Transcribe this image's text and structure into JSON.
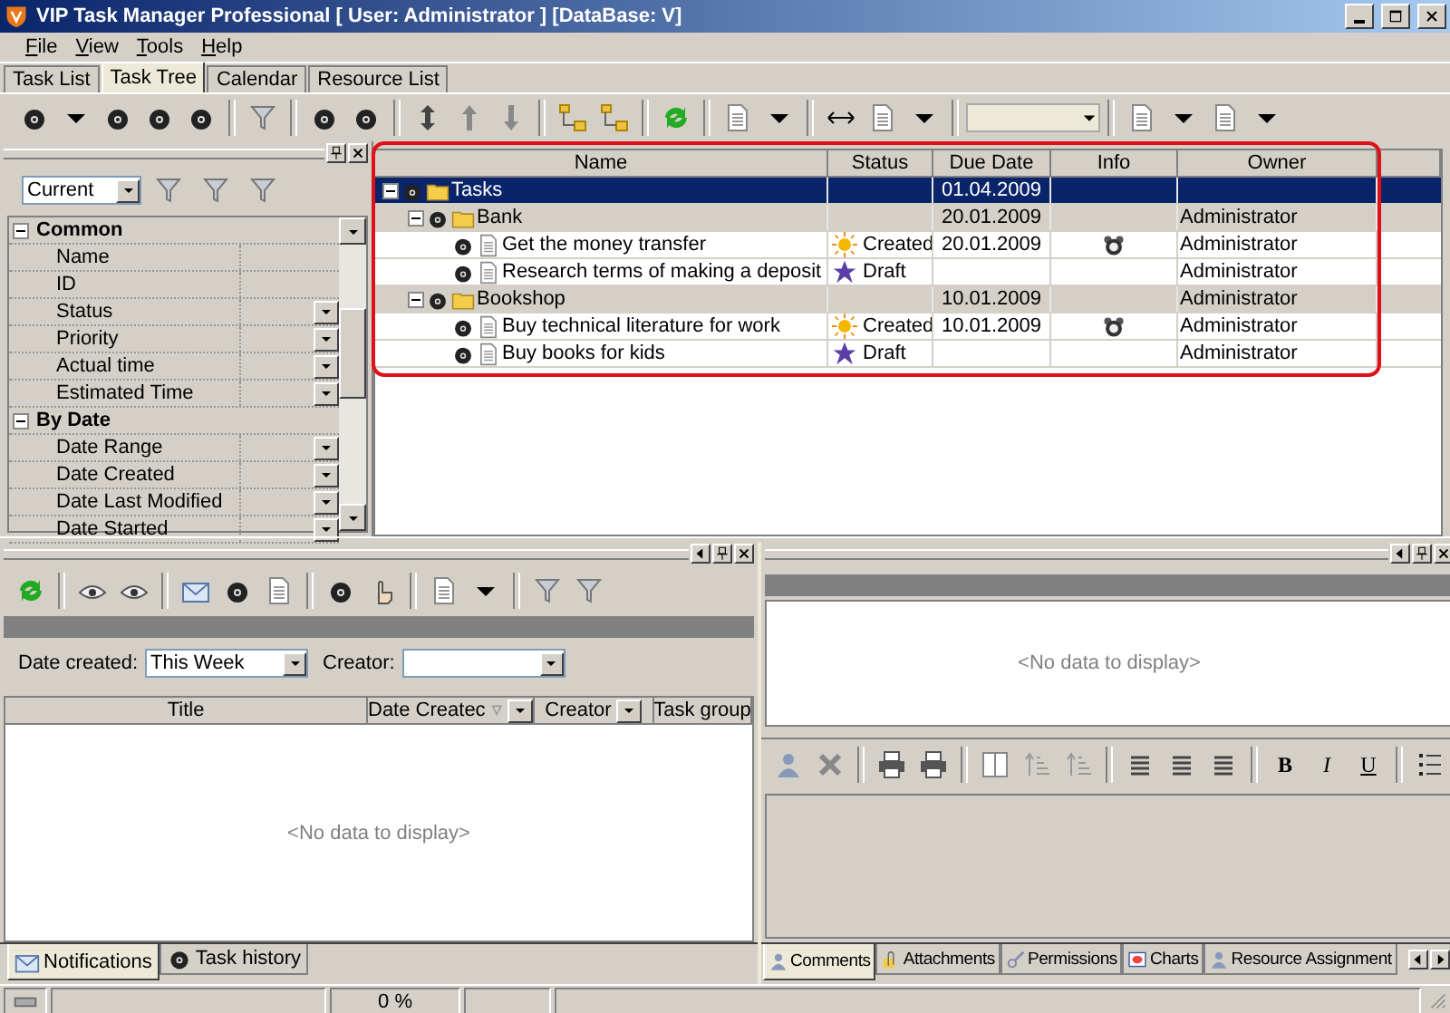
{
  "window": {
    "title": "VIP Task Manager Professional [ User: Administrator ] [DataBase: V]"
  },
  "menu": [
    {
      "label": "File"
    },
    {
      "label": "View"
    },
    {
      "label": "Tools"
    },
    {
      "label": "Help"
    }
  ],
  "tabs": [
    {
      "label": "Task List",
      "selected": false
    },
    {
      "label": "Task Tree",
      "selected": true
    },
    {
      "label": "Calendar",
      "selected": false
    },
    {
      "label": "Resource List",
      "selected": false
    }
  ],
  "filter_panel": {
    "view": "Current",
    "groups": [
      {
        "label": "Common",
        "expanded": true,
        "fields": [
          {
            "label": "Name",
            "dropdown": false
          },
          {
            "label": "ID",
            "dropdown": false
          },
          {
            "label": "Status",
            "dropdown": true
          },
          {
            "label": "Priority",
            "dropdown": true
          },
          {
            "label": "Actual time",
            "dropdown": true
          },
          {
            "label": "Estimated Time",
            "dropdown": true
          }
        ]
      },
      {
        "label": "By Date",
        "expanded": true,
        "fields": [
          {
            "label": "Date Range",
            "dropdown": true
          },
          {
            "label": "Date Created",
            "dropdown": true
          },
          {
            "label": "Date Last Modified",
            "dropdown": true
          },
          {
            "label": "Date Started",
            "dropdown": true
          }
        ]
      }
    ]
  },
  "tree": {
    "columns": [
      "Name",
      "Status",
      "Due Date",
      "Info",
      "Owner"
    ],
    "rows": [
      {
        "name": "Tasks",
        "kind": "group",
        "selected": true,
        "expanded": true,
        "due_date": "01.04.2009",
        "children": [
          {
            "name": "Bank",
            "kind": "group",
            "selected": false,
            "expanded": true,
            "due_date": "20.01.2009",
            "owner": "Administrator",
            "children": [
              {
                "name": "Get the money transfer",
                "kind": "task",
                "selected": false,
                "status": {
                  "kind": "created",
                  "label": "Created"
                },
                "due_date": "20.01.2009",
                "reminder": true,
                "owner": "Administrator"
              },
              {
                "name": "Research terms of making a deposit",
                "kind": "task",
                "selected": false,
                "status": {
                  "kind": "draft",
                  "label": "Draft"
                },
                "reminder": false,
                "owner": "Administrator"
              }
            ]
          },
          {
            "name": "Bookshop",
            "kind": "group",
            "selected": false,
            "expanded": true,
            "due_date": "10.01.2009",
            "owner": "Administrator",
            "children": [
              {
                "name": "Buy technical literature for work",
                "kind": "task",
                "selected": false,
                "status": {
                  "kind": "created",
                  "label": "Created"
                },
                "due_date": "10.01.2009",
                "reminder": true,
                "owner": "Administrator"
              },
              {
                "name": "Buy books for kids",
                "kind": "task",
                "selected": false,
                "status": {
                  "kind": "draft",
                  "label": "Draft"
                },
                "reminder": false,
                "owner": "Administrator"
              }
            ]
          }
        ]
      }
    ]
  },
  "notifications": {
    "date_created": {
      "label": "Date created:",
      "value": "This Week"
    },
    "creator": {
      "label": "Creator:"
    },
    "columns": [
      {
        "label": "Title",
        "filter": false
      },
      {
        "label": "Date Createc",
        "filter": true,
        "sorted": true
      },
      {
        "label": "Creator",
        "filter": true
      },
      {
        "label": "Task group",
        "filter": false
      }
    ],
    "empty_text": "<No data to display>",
    "tabs": [
      {
        "label": "Notifications",
        "selected": true
      },
      {
        "label": "Task history",
        "selected": false
      }
    ]
  },
  "details": {
    "empty_text": "<No data to display>",
    "format_buttons": [
      {
        "label": "B",
        "kind": "bold"
      },
      {
        "label": "I",
        "kind": "italic"
      },
      {
        "label": "U",
        "kind": "underline"
      }
    ],
    "tabs": [
      {
        "label": "Comments",
        "selected": true
      },
      {
        "label": "Attachments",
        "selected": false
      },
      {
        "label": "Permissions",
        "selected": false
      },
      {
        "label": "Charts",
        "selected": false
      },
      {
        "label": "Resource Assignment",
        "selected": false
      }
    ]
  },
  "status_bar": {
    "progress": "0 %"
  }
}
